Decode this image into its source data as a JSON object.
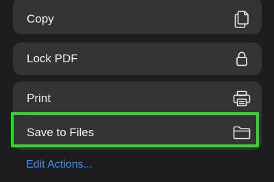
{
  "menu": {
    "copy": {
      "label": "Copy",
      "icon": "copy-icon"
    },
    "lock_pdf": {
      "label": "Lock PDF",
      "icon": "lock-icon"
    },
    "print": {
      "label": "Print",
      "icon": "printer-icon"
    },
    "save_to_files": {
      "label": "Save to Files",
      "icon": "folder-icon"
    }
  },
  "edit_actions_label": "Edit Actions...",
  "colors": {
    "background": "#1d1d1f",
    "row_background": "#343437",
    "highlight": "#22e01c",
    "link": "#3a8fff"
  }
}
